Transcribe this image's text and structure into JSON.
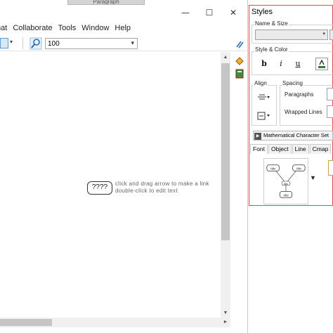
{
  "background_tab": {
    "label": "Paragraph"
  },
  "window_controls": {
    "minimize": "—",
    "maximize": "☐",
    "close": "✕"
  },
  "menu": {
    "items": [
      {
        "id": "format",
        "label": "mat"
      },
      {
        "id": "collaborate",
        "label": "Collaborate"
      },
      {
        "id": "tools",
        "label": "Tools"
      },
      {
        "id": "window",
        "label": "Window"
      },
      {
        "id": "help",
        "label": "Help"
      }
    ]
  },
  "toolbar": {
    "zoom_value": "100",
    "dropdown_arrow": "▾",
    "small_arrow": "▾"
  },
  "canvas": {
    "node_text": "????",
    "hint_line1": "click and drag arrow to make a link",
    "hint_line2": "double-click to edit text"
  },
  "scroll": {
    "up": "▲",
    "down": "▼",
    "right": "►"
  },
  "styles_panel": {
    "title": "Styles",
    "name_size_label": "Name & Size",
    "style_color_label": "Style & Color",
    "bold": "b",
    "italic": "i",
    "underline": "u",
    "text_color": "#2e7d32",
    "align_label": "Align",
    "spacing_label": "Spacing",
    "paragraphs_label": "Paragraphs",
    "wrapped_lines_label": "Wrapped Lines",
    "charset_label": "Mathematical Character Set",
    "tabs": [
      "Font",
      "Object",
      "Line",
      "Cmap"
    ],
    "active_tab": "Font",
    "preview_nodes": [
      "Abc",
      "Abc",
      "Abc",
      "Abc"
    ],
    "preview_arrow": "▼"
  },
  "colors": {
    "panel_border": "#e04a4a",
    "accent_blue": "#5a9bd5"
  },
  "icons": {
    "zoom": "zoom-magnifier-icon",
    "right_tool_1": "link-tool-icon",
    "right_tool_2": "paint-bucket-icon",
    "right_tool_3": "book-icon"
  }
}
